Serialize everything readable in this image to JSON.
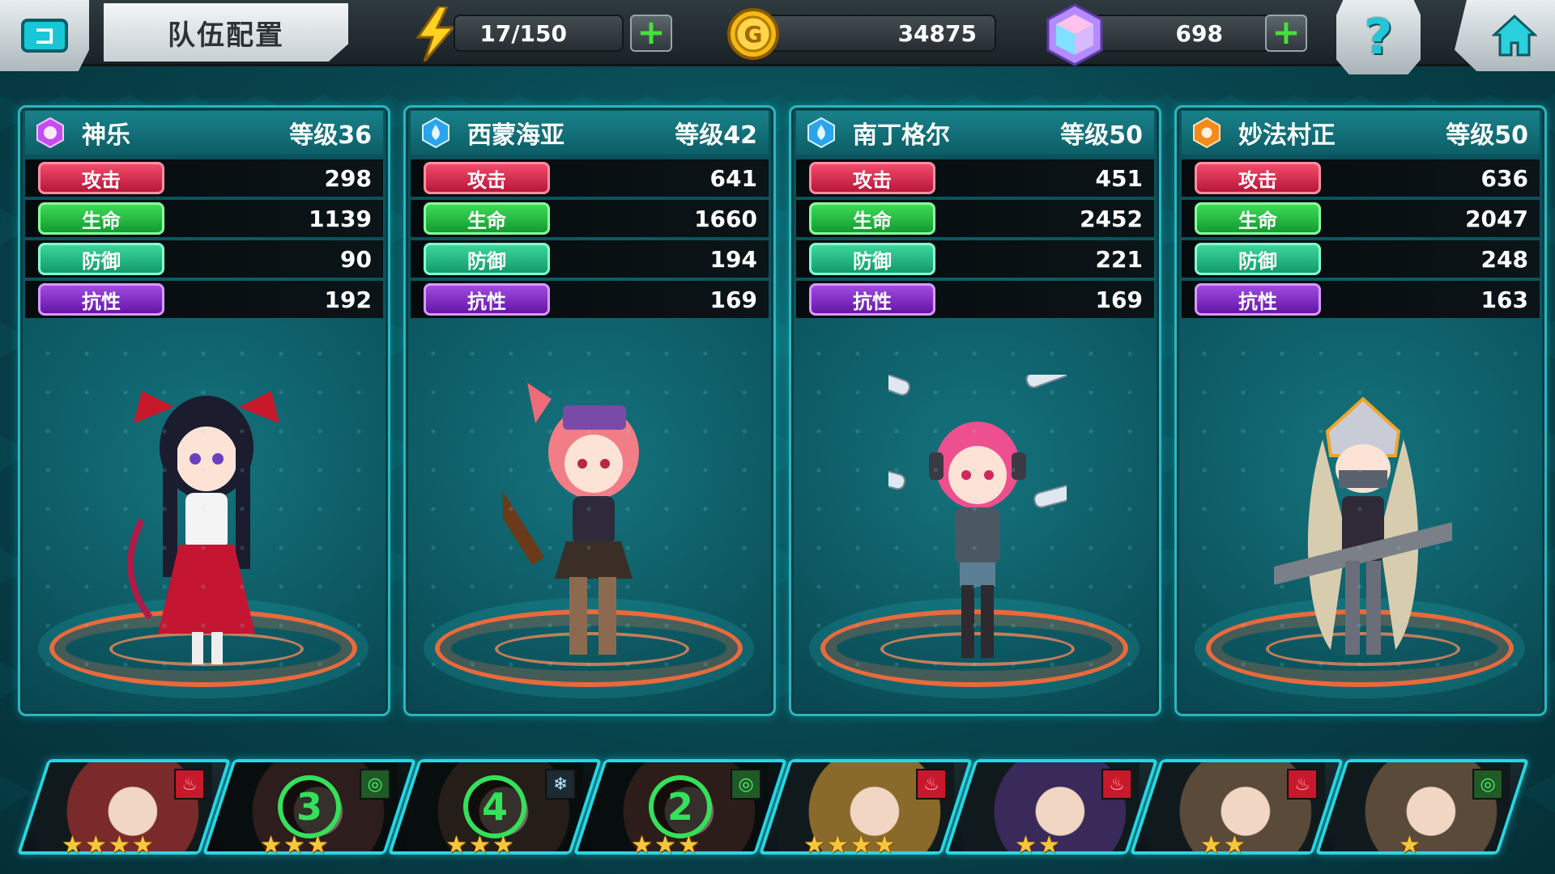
{
  "header": {
    "title": "队伍配置",
    "energy": "17/150",
    "gold": "34875",
    "gems": "698",
    "help_label": "?"
  },
  "colors": {
    "accent": "#27d7e3",
    "attack": "#e8284e",
    "hp": "#26c544",
    "defense": "#20c07f",
    "resist": "#8a2fd0"
  },
  "stat_labels": {
    "attack": "攻击",
    "hp": "生命",
    "defense": "防御",
    "resist": "抗性"
  },
  "team": [
    {
      "name": "神乐",
      "level": "等级36",
      "element": "spirit-icon",
      "attack": "298",
      "hp": "1139",
      "defense": "90",
      "resist": "192"
    },
    {
      "name": "西蒙海亚",
      "level": "等级42",
      "element": "water-icon",
      "attack": "641",
      "hp": "1660",
      "defense": "194",
      "resist": "169"
    },
    {
      "name": "南丁格尔",
      "level": "等级50",
      "element": "water-icon",
      "attack": "451",
      "hp": "2452",
      "defense": "221",
      "resist": "169"
    },
    {
      "name": "妙法村正",
      "level": "等级50",
      "element": "sun-icon",
      "attack": "636",
      "hp": "2047",
      "defense": "248",
      "resist": "163"
    }
  ],
  "roster": [
    {
      "element": "fire",
      "stars": 4,
      "rank": ""
    },
    {
      "element": "wind",
      "stars": 3,
      "rank": "3"
    },
    {
      "element": "ice",
      "stars": 3,
      "rank": "4"
    },
    {
      "element": "wind",
      "stars": 3,
      "rank": "2"
    },
    {
      "element": "fire",
      "stars": 4,
      "rank": ""
    },
    {
      "element": "fire",
      "stars": 2,
      "rank": ""
    },
    {
      "element": "fire",
      "stars": 2,
      "rank": ""
    },
    {
      "element": "wind",
      "stars": 1,
      "rank": ""
    }
  ]
}
